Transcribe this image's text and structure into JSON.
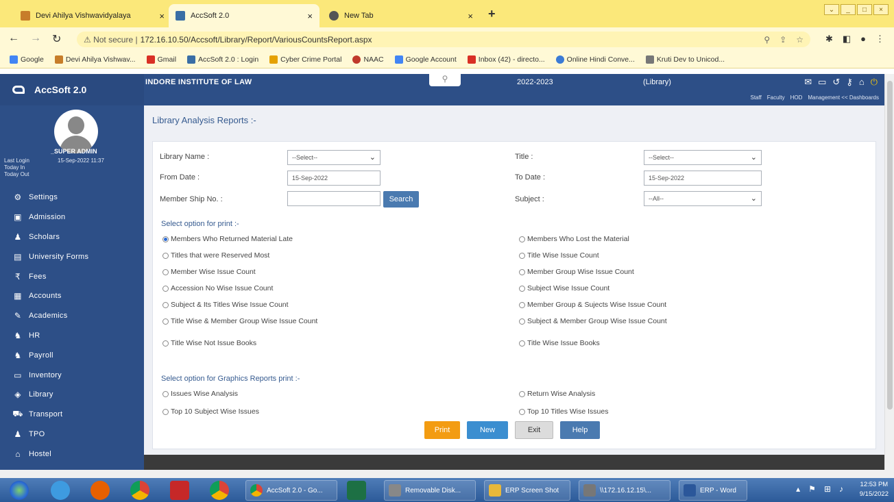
{
  "browser": {
    "tabs": [
      {
        "label": "Devi Ahilya Vishwavidyalaya",
        "close": "×"
      },
      {
        "label": "AccSoft 2.0",
        "close": "×"
      },
      {
        "label": "New Tab",
        "close": "×"
      }
    ],
    "new_tab": "+",
    "url_prefix": "Not secure |",
    "url": "172.16.10.50/Accsoft/Library/Report/VariousCountsReport.aspx",
    "bookmarks": [
      "Google",
      "Devi Ahilya Vishwav...",
      "Gmail",
      "AccSoft 2.0 : Login",
      "Cyber Crime Portal",
      "NAAC",
      "Google Account",
      "Inbox (42) - directo...",
      "Online Hindi Conve...",
      "Kruti Dev to Unicod..."
    ]
  },
  "header": {
    "app_name": "AccSoft 2.0",
    "institute": "INDORE INSTITUTE OF LAW",
    "year": "2022-2023",
    "module": "(Library)",
    "links": [
      "Staff",
      "Faculty",
      "HOD",
      "Management << Dashboards"
    ]
  },
  "user": {
    "name": "_SUPER ADMIN",
    "last_login_label": "Last Login",
    "last_login_value": "15-Sep-2022 11:37",
    "today_in": "Today In",
    "today_out": "Today Out"
  },
  "menu": [
    {
      "label": "Settings",
      "icon": "⚙"
    },
    {
      "label": "Admission",
      "icon": "▣"
    },
    {
      "label": "Scholars",
      "icon": "♟"
    },
    {
      "label": "University Forms",
      "icon": "▤"
    },
    {
      "label": "Fees",
      "icon": "₹"
    },
    {
      "label": "Accounts",
      "icon": "▦"
    },
    {
      "label": "Academics",
      "icon": "✎"
    },
    {
      "label": "HR",
      "icon": "♞"
    },
    {
      "label": "Payroll",
      "icon": "♞"
    },
    {
      "label": "Inventory",
      "icon": "▭"
    },
    {
      "label": "Library",
      "icon": "◈"
    },
    {
      "label": "Transport",
      "icon": "⛟"
    },
    {
      "label": "TPO",
      "icon": "♟"
    },
    {
      "label": "Hostel",
      "icon": "⌂"
    }
  ],
  "page": {
    "title": "Library Analysis Reports :-",
    "library_name_label": "Library Name :",
    "library_name_value": "--Select--",
    "title_label": "Title :",
    "title_value": "--Select--",
    "from_date_label": "From Date :",
    "from_date_value": "15-Sep-2022",
    "to_date_label": "To Date :",
    "to_date_value": "15-Sep-2022",
    "membership_label": "Member Ship No. :",
    "membership_value": "",
    "search_button": "Search",
    "subject_label": "Subject :",
    "subject_value": "--All--",
    "print_section": "Select option for print :-",
    "print_options_left": [
      "Members Who Returned Material Late",
      "Titles that were Reserved Most",
      "Member Wise Issue Count",
      "Accession No Wise Issue Count",
      "Subject & Its Titles Wise Issue Count",
      "Title Wise & Member Group Wise Issue Count",
      "Title Wise Not Issue Books"
    ],
    "print_options_right": [
      "Members Who Lost the Material",
      "Title Wise Issue Count",
      "Member Group Wise Issue Count",
      "Subject Wise Issue Count",
      "Member Group & Sujects Wise Issue Count",
      "Subject & Member Group Wise Issue Count",
      "Title Wise Issue Books"
    ],
    "graphics_section": "Select option for Graphics Reports print :-",
    "graphics_left": [
      "Issues Wise Analysis",
      "Top 10 Subject Wise Issues"
    ],
    "graphics_right": [
      "Return Wise Analysis",
      "Top 10 Titles Wise Issues"
    ],
    "buttons": {
      "print": "Print",
      "new": "New",
      "exit": "Exit",
      "help": "Help"
    }
  },
  "taskbar": {
    "windows": [
      "AccSoft 2.0 - Go...",
      "Removable Disk...",
      "ERP Screen Shot",
      "\\\\172.16.12.15\\...",
      "ERP - Word"
    ],
    "time": "12:53 PM",
    "date": "9/15/2022"
  },
  "colors": {
    "header": "#2d4f87",
    "print": "#f39c12",
    "new": "#3b8ed0",
    "exit": "#dcdcdc",
    "help": "#4a7ab0"
  }
}
